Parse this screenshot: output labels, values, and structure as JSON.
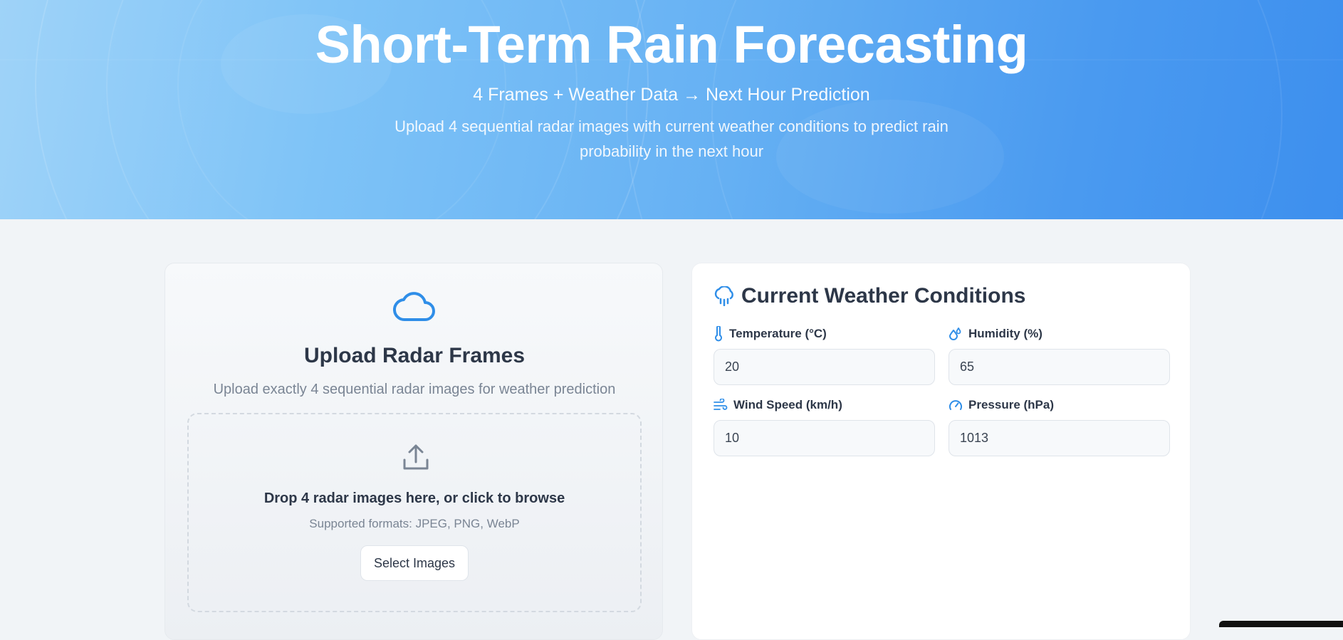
{
  "hero": {
    "title": "Short-Term Rain Forecasting",
    "subtitle": "4 Frames + Weather Data → Next Hour Prediction",
    "description": "Upload 4 sequential radar images with current weather conditions to predict rain probability in the next hour"
  },
  "upload": {
    "icon": "cloud-icon",
    "title": "Upload Radar Frames",
    "description": "Upload exactly 4 sequential radar images for weather prediction",
    "dropzone": {
      "icon": "upload-icon",
      "text": "Drop 4 radar images here, or click to browse",
      "formats": "Supported formats: JPEG, PNG, WebP",
      "button_label": "Select Images"
    }
  },
  "weather": {
    "icon": "cloud-rain-icon",
    "title": "Current Weather Conditions",
    "fields": [
      {
        "label": "Temperature (°C)",
        "value": "20",
        "icon": "thermometer-icon"
      },
      {
        "label": "Humidity (%)",
        "value": "65",
        "icon": "droplets-icon"
      },
      {
        "label": "Wind Speed (km/h)",
        "value": "10",
        "icon": "wind-icon"
      },
      {
        "label": "Pressure (hPa)",
        "value": "1013",
        "icon": "gauge-icon"
      }
    ]
  },
  "colors": {
    "accent": "#2f8ee8",
    "hero_start": "#9fd3f8",
    "hero_end": "#3d8fee",
    "text_dark": "#2d3748",
    "text_muted": "#7a8594"
  }
}
